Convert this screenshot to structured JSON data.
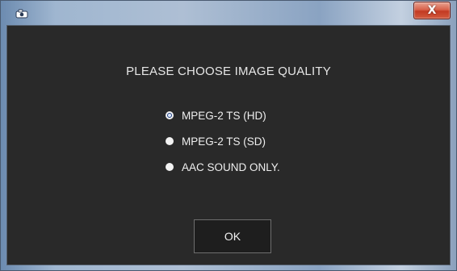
{
  "window": {
    "icon": "camera-icon",
    "close_label": "X"
  },
  "dialog": {
    "heading": "PLEASE CHOOSE IMAGE QUALITY",
    "options": [
      {
        "label": "MPEG-2 TS (HD)",
        "selected": true
      },
      {
        "label": "MPEG-2 TS (SD)",
        "selected": false
      },
      {
        "label": "AAC SOUND ONLY.",
        "selected": false
      }
    ],
    "ok_label": "OK"
  },
  "colors": {
    "client_background": "#292929",
    "close_button": "#c23a23",
    "text": "#e6e6e6"
  }
}
